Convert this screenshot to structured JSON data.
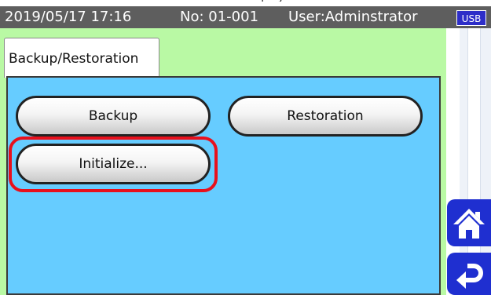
{
  "top": {
    "partial_text": "splay"
  },
  "status_bar": {
    "datetime": "2019/05/17 17:16",
    "number": "No: 01-001",
    "user": "User:Adminstrator",
    "usb": "USB"
  },
  "tabs": [
    {
      "label": "Backup/Restoration"
    }
  ],
  "buttons": {
    "backup": "Backup",
    "restoration": "Restoration",
    "initialize": "Initialize..."
  },
  "icons": {
    "home": "home-icon",
    "back": "return-arrow-icon"
  },
  "colors": {
    "status_bar": "#5e5e5e",
    "background": "#b9f9a4",
    "panel": "#66ccff",
    "highlight": "#e8101c",
    "nav_button": "#1f2fd0",
    "usb_badge": "#2e2ec8"
  }
}
